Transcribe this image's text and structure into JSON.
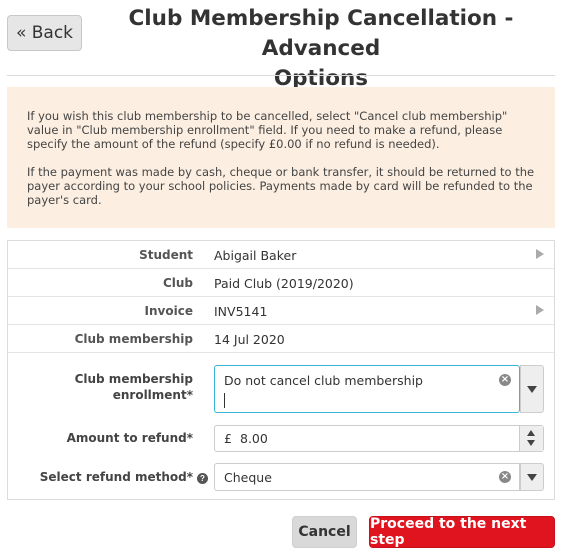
{
  "header": {
    "back_label": "« Back",
    "title_line1": "Club Membership Cancellation - Advanced",
    "title_line2": "Options"
  },
  "info": {
    "paragraph1": "If you wish this club membership to be cancelled, select \"Cancel club membership\" value in \"Club membership enrollment\" field. If you need to make a refund, please specify the amount of the refund (specify £0.00 if no refund is needed).",
    "paragraph2": "If the payment was made by cash, cheque or bank transfer, it should be returned to the payer according to your school policies. Payments made by card will be refunded to the payer's card."
  },
  "details": {
    "student_label": "Student",
    "student_value": "Abigail Baker",
    "club_label": "Club",
    "club_value": "Paid Club (2019/2020)",
    "invoice_label": "Invoice",
    "invoice_value": "INV5141",
    "membership_label": "Club membership",
    "membership_value": "14 Jul 2020"
  },
  "form": {
    "enrollment_label_line1": "Club membership",
    "enrollment_label_line2": "enrollment*",
    "enrollment_value": "Do not cancel club membership",
    "amount_label": "Amount to refund*",
    "amount_currency": "£",
    "amount_value": "8.00",
    "method_label": "Select refund method*",
    "method_value": "Cheque"
  },
  "actions": {
    "cancel_label": "Cancel",
    "proceed_label": "Proceed to the next step"
  },
  "colors": {
    "accent_red": "#e0141f",
    "info_bg": "#fcefe2",
    "focus_border": "#39b3d7"
  }
}
